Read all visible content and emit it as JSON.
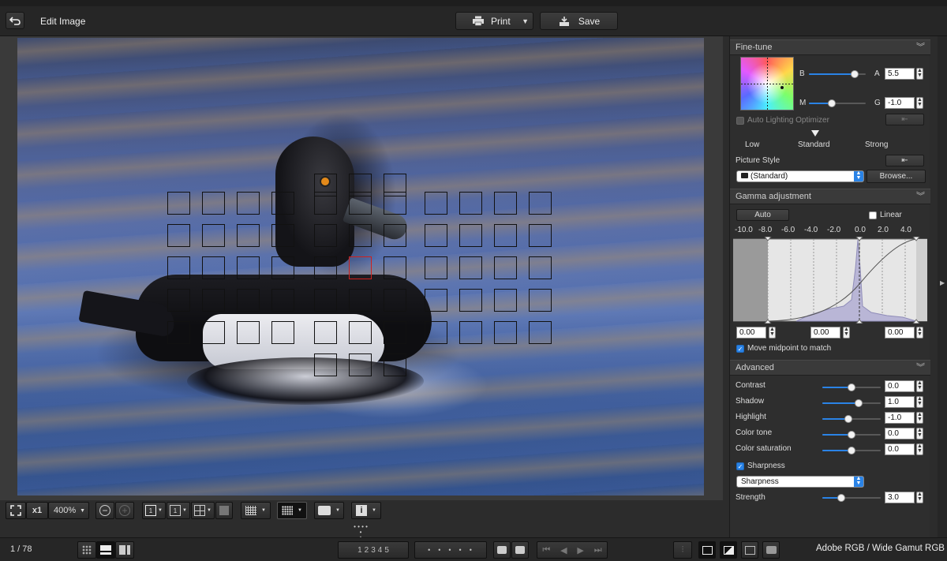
{
  "window": {
    "title": "Edit Image"
  },
  "toolbar": {
    "print_label": "Print",
    "save_label": "Save"
  },
  "viewer": {
    "zoom_multiplier": "x1",
    "zoom_level": "400%",
    "af_points": 63,
    "selected_af_row": 2,
    "selected_af_col": 5
  },
  "fine_tune": {
    "title": "Fine-tune",
    "color_wheel": {
      "b_label": "B",
      "a_label": "A",
      "a_value": "5.5",
      "m_label": "M",
      "g_label": "G",
      "g_value": "-1.0",
      "b_slider": 0.8,
      "m_slider": 0.4
    },
    "alo": {
      "label": "Auto Lighting Optimizer",
      "checked": false,
      "levels": [
        "Low",
        "Standard",
        "Strong"
      ],
      "selected_level": "Standard"
    },
    "picture_style": {
      "label": "Picture Style",
      "value": "(Standard)",
      "browse_label": "Browse..."
    }
  },
  "gamma": {
    "title": "Gamma adjustment",
    "auto_label": "Auto",
    "linear_label": "Linear",
    "linear_checked": false,
    "scale": [
      "-10.0",
      "-8.0",
      "-6.0",
      "-4.0",
      "-2.0",
      "0.0",
      "2.0",
      "4.0"
    ],
    "inputs": {
      "low": "0.00",
      "mid": "0.00",
      "high": "0.00"
    },
    "move_midpoint_label": "Move midpoint to match",
    "move_midpoint_checked": true
  },
  "advanced": {
    "title": "Advanced",
    "rows": [
      {
        "label": "Contrast",
        "value": "0.0",
        "pos": 0.5
      },
      {
        "label": "Shadow",
        "value": "1.0",
        "pos": 0.62
      },
      {
        "label": "Highlight",
        "value": "-1.0",
        "pos": 0.44
      },
      {
        "label": "Color tone",
        "value": "0.0",
        "pos": 0.5
      },
      {
        "label": "Color saturation",
        "value": "0.0",
        "pos": 0.5
      }
    ],
    "sharpness": {
      "label": "Sharpness",
      "checked": true,
      "mode": "Sharpness",
      "strength_label": "Strength",
      "strength_value": "3.0",
      "strength_pos": 0.33
    }
  },
  "status": {
    "page": "1 / 78",
    "color_space": "Adobe RGB / Wide Gamut RGB",
    "slots": [
      "1",
      "2",
      "3",
      "4",
      "5"
    ]
  },
  "colors": {
    "accent": "#2a83e6",
    "af_selected": "#d0201c",
    "panel_bg": "#2e2e2e"
  }
}
